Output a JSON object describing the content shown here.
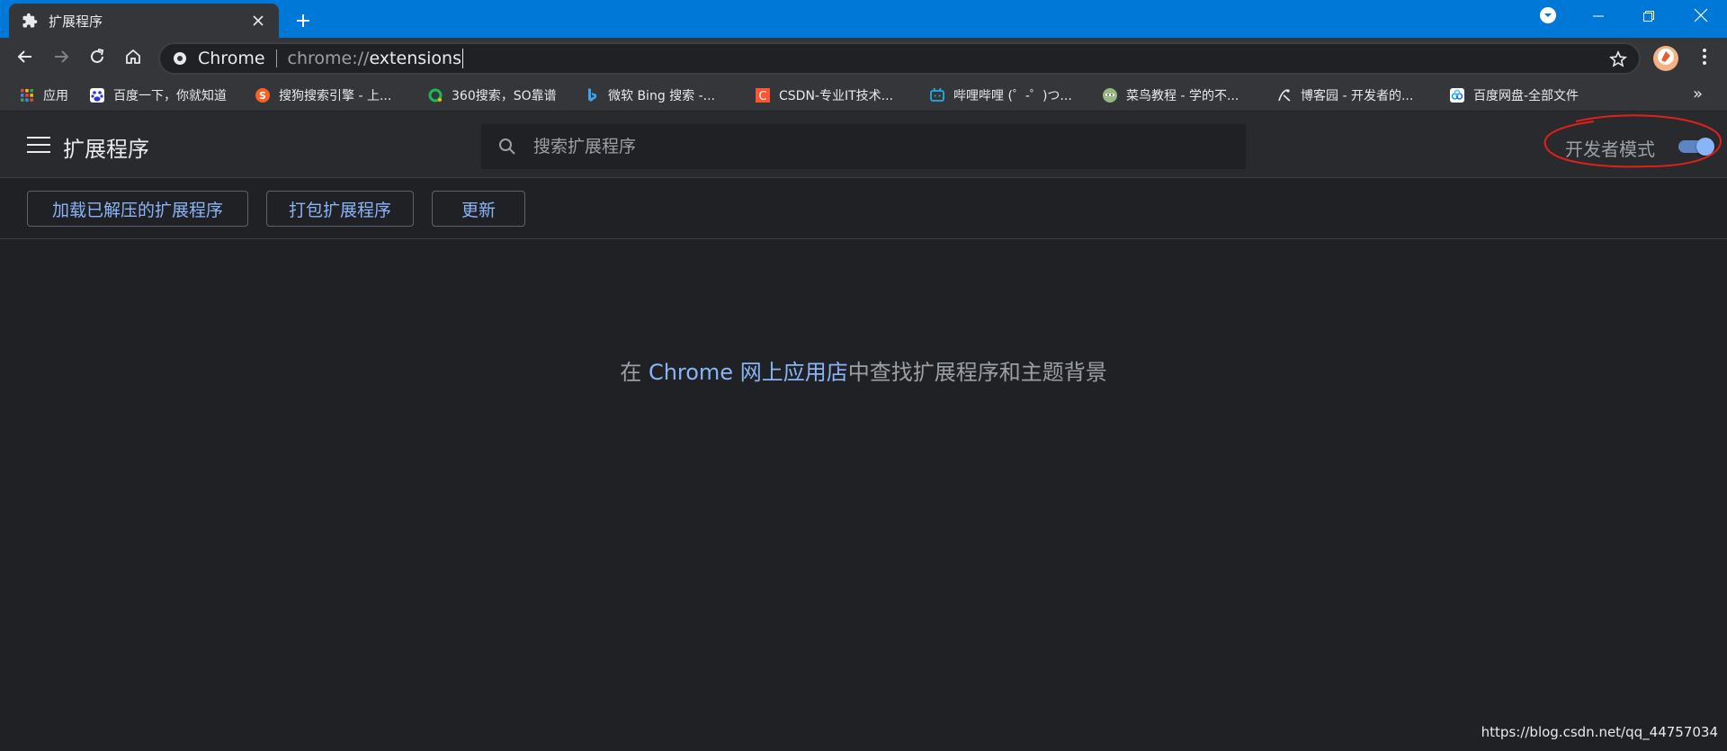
{
  "tab": {
    "title": "扩展程序"
  },
  "omnibox": {
    "chip": "Chrome",
    "scheme": "chrome://",
    "host": "extensions"
  },
  "bookmarks": [
    {
      "label": "应用",
      "icon": "apps-grid-icon"
    },
    {
      "label": "百度一下，你就知道",
      "icon": "baidu-icon"
    },
    {
      "label": "搜狗搜索引擎 - 上...",
      "icon": "sogou-icon"
    },
    {
      "label": "360搜索，SO靠谱",
      "icon": "so360-icon"
    },
    {
      "label": "微软 Bing 搜索 -...",
      "icon": "bing-icon"
    },
    {
      "label": "CSDN-专业IT技术...",
      "icon": "csdn-icon"
    },
    {
      "label": "哔哩哔哩 (゜-゜)つ...",
      "icon": "bilibili-icon"
    },
    {
      "label": "菜鸟教程 - 学的不...",
      "icon": "runoob-icon"
    },
    {
      "label": "博客园 - 开发者的...",
      "icon": "cnblogs-icon"
    },
    {
      "label": "百度网盘-全部文件",
      "icon": "baidu-pan-icon"
    }
  ],
  "bookmarks_more": "»",
  "header": {
    "title": "扩展程序",
    "search_placeholder": "搜索扩展程序",
    "dev_mode_label": "开发者模式",
    "dev_mode_on": true
  },
  "actions": {
    "load_unpacked": "加载已解压的扩展程序",
    "pack": "打包扩展程序",
    "update": "更新"
  },
  "empty": {
    "prefix": "在 ",
    "link": "Chrome 网上应用店",
    "suffix": "中查找扩展程序和主题背景"
  },
  "watermark": "https://blog.csdn.net/qq_44757034",
  "colors": {
    "titlebar": "#0078d7",
    "toolbar": "#35363a",
    "page_bg": "#202124",
    "header_bg": "#292a2d",
    "accent": "#8ab4f8",
    "annotation": "#e0201c"
  }
}
